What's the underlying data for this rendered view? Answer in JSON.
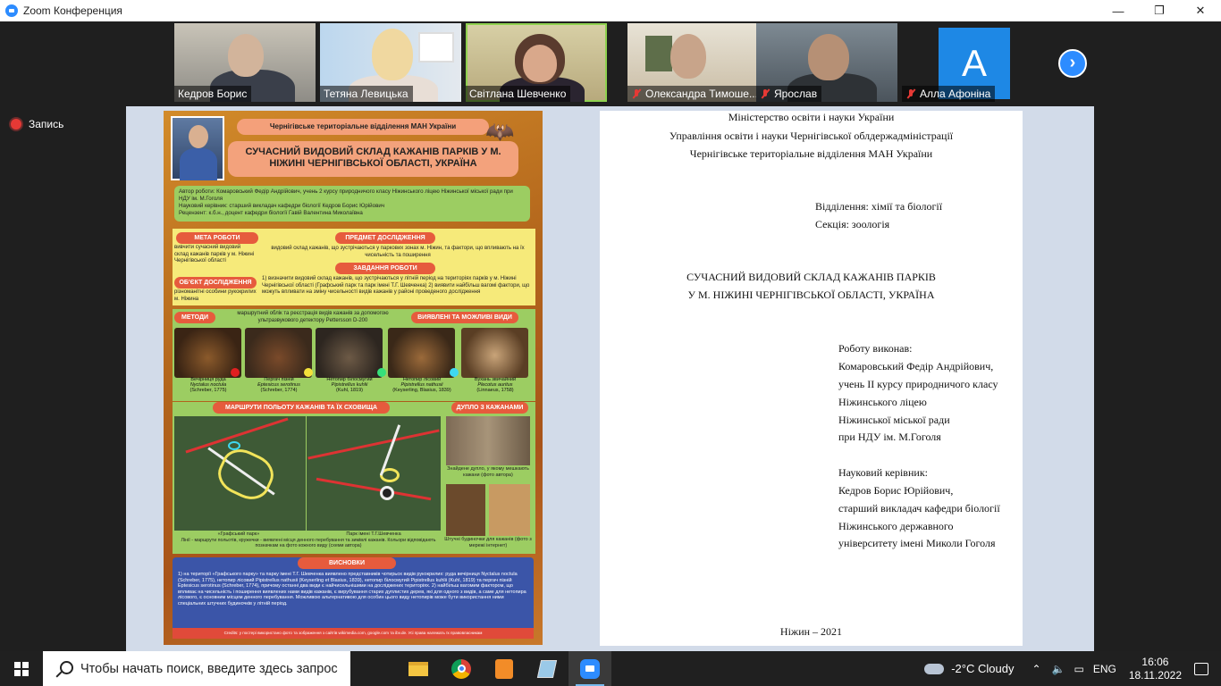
{
  "window": {
    "title": "Zoom Конференция"
  },
  "participants": [
    {
      "name": "Кедров Борис",
      "muted": false
    },
    {
      "name": "Тетяна Левицька",
      "muted": false
    },
    {
      "name": "Світлана Шевченко",
      "muted": false,
      "active": true
    },
    {
      "name": "Олександра Тимоше...",
      "muted": true
    },
    {
      "name": "Ярослав",
      "muted": true
    },
    {
      "name": "Алла Афоніна",
      "muted": true,
      "avatar_letter": "A"
    }
  ],
  "recording": {
    "label": "Запись"
  },
  "poster": {
    "org_banner": "Чернігівське територіальне відділення МАН України",
    "title": "СУЧАСНИЙ ВИДОВИЙ СКЛАД КАЖАНІВ ПАРКІВ У М. НІЖИНІ ЧЕРНІГІВСЬКОЇ ОБЛАСТІ, УКРАЇНА",
    "authors": "Автор роботи: Комаровський Федір Андрійович, учень 2 курсу природничого класу Ніжинського ліцею Ніжинської міської ради при НДУ ім. М.Гоголя",
    "supervisor": "Науковий керівник: старший викладач кафедри біології Кедров Борис Юрійович",
    "reviewer": "Рецензент: к.б.н., доцент кафедри біології Гавій Валентина Миколаївна",
    "goal_label": "МЕТА РОБОТИ",
    "goal_text": "вивчити сучасний видовий склад кажанів парків у м. Ніжині Чернігівської області",
    "subject_label": "ПРЕДМЕТ ДОСЛІДЖЕННЯ",
    "subject_text": "видовий склад кажанів, що зустрічаються у паркових зонах м. Ніжин, та фактори, що впливають на їх чисельність та поширення",
    "tasks_label": "ЗАВДАННЯ РОБОТИ",
    "tasks_text": "1) визначити видовий склад кажанів, що зустрічаються у літній період на територіях парків у м. Ніжині Чернігівської області (Графський парк та парк імені Т.Г. Шевченка) 2) виявити найбільш вагомі фактори, що можуть впливати на зміну чисельності видів кажанів у районі проведеного дослідження",
    "object_label": "ОБ'ЄКТ ДОСЛІДЖЕННЯ",
    "object_text": "різноманітні особини рукокрилих м. Ніжина",
    "methods_label": "МЕТОДИ",
    "methods_text": "маршрутний облік та реєстрація видів кажанів за допомогою ультразвукового детектору Pettersson D-200",
    "species_label": "ВИЯВЛЕНІ ТА МОЖЛИВІ ВИДИ",
    "species": [
      {
        "name": "Вечірниця руда",
        "latin": "Nyctalus noctula",
        "author": "(Schreber, 1775)",
        "color": "#e02020"
      },
      {
        "name": "Пергач пізній",
        "latin": "Eptesicus serotinus",
        "author": "(Schreber, 1774)",
        "color": "#f3e13a"
      },
      {
        "name": "Нетопир білосмугий",
        "latin": "Pipistrellus kuhlii",
        "author": "(Kuhl, 1819)",
        "color": "#36e07a"
      },
      {
        "name": "Нетопир лісовий",
        "latin": "Pipistrellus nathusii",
        "author": "(Keyserling, Blasius, 1839)",
        "color": "#3fd8f0"
      },
      {
        "name": "Вухань звичайний",
        "latin": "Plecotus auritus",
        "author": "(Linnaeus, 1758)",
        "color": ""
      }
    ],
    "routes_label": "МАРШРУТИ ПОЛЬОТУ КАЖАНІВ ТА ЇХ СХОВИЩА",
    "hollow_label": "ДУПЛО З КАЖАНАМИ",
    "hollow_caption": "Знайдене дупло, у якому мешкають кажани (фото автора)",
    "boxes_caption": "Штучні будиночки для кажанів (фото з мережі інтернет)",
    "map_caption_1": "«Графський парк»",
    "map_caption_2": "Парк імені Т.Г.Шевченка",
    "map_legend": "Лінії - маршрути польотів, кружечки - виявлені місця денного перебування та зимівлі кажанів. Кольори відповідають позначкам на фото кожного виду (схеми автора)",
    "conclusions_label": "ВИСНОВКИ",
    "conclusions_text": "1) на території «Графського парку» та парку імені Т.Г. Шевченка виявлено представників чотирьох видів рукокрилих: руда вечірниця Nyctalus noctula (Schreber, 1775), нетопир лісовий Pipistrellus nathusii (Keyserling et Blasius, 1839), нетопир білосмугий Pipistrellus kuhlii (Kuhl, 1819) та пергач пізній Eptesicus serotinus (Schreber, 1774), причому останні два види є найчисельнішими на досліджених територіях. 2) найбільш вагомим фактором, що впливає на чисельність і поширення виявлених нами видів кажанів, є вирубування старих дуплистих дерев, які для одного з видів, а саме для нетопира лісового, є основним місцем денного перебування. Можливою альтернативою для особин цього виду нетопирів може бути використання ними спеціальних штучних будиночків у літній період.",
    "credits": "Credits: у постері використано фото та зображення з сайтів wikimedia.com, google.com та ibv.de. Усі права належать їх правовласникам"
  },
  "document": {
    "header_1": "Міністерство освіти і науки України",
    "header_2": "Управління освіти і науки Чернігівської облдержадміністрації",
    "header_3": "Чернігівське територіальне відділення МАН України",
    "dept": "Відділення: хімії та біології",
    "section": "Секція:  зоологія",
    "title_1": "СУЧАСНИЙ ВИДОВИЙ СКЛАД КАЖАНІВ ПАРКІВ",
    "title_2": "У М. НІЖИНІ ЧЕРНІГІВСЬКОЇ ОБЛАСТІ, УКРАЇНА",
    "author_lines": [
      "Роботу виконав:",
      "Комаровський Федір Андрійович,",
      "учень ІІ курсу природничого класу",
      "Ніжинського ліцею",
      "Ніжинської міської ради",
      "при НДУ ім. М.Гоголя"
    ],
    "supervisor_lines": [
      "Науковий керівник:",
      "Кедров Борис Юрійович,",
      "старший викладач кафедри біології",
      "Ніжинського державного",
      "університету імені Миколи Гоголя"
    ],
    "footer": "Ніжин – 2021"
  },
  "taskbar": {
    "search_placeholder": "Чтобы начать поиск, введите здесь запрос",
    "weather": "-2°C  Cloudy",
    "lang": "ENG",
    "time": "16:06",
    "date": "18.11.2022"
  }
}
